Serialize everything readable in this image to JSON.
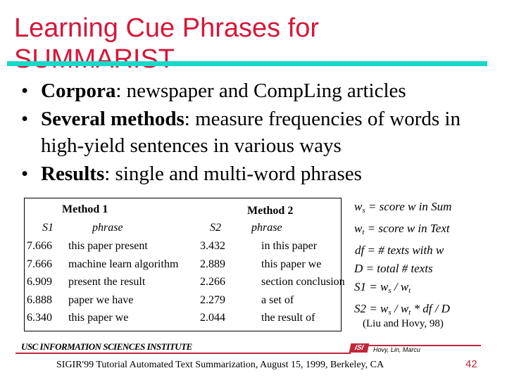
{
  "slide": {
    "title_line1": "Learning Cue Phrases for",
    "title_line2": "SUMMARIST",
    "accent_color": "#d5173a",
    "rule_color": "#19d8c8"
  },
  "bullets": [
    {
      "bold": "Corpora",
      "rest": ": newspaper and CompLing articles"
    },
    {
      "bold": "Several methods",
      "rest": ": measure frequencies of words in high-yield sentences in various ways"
    },
    {
      "bold": "Results",
      "rest": ": single and multi-word phrases"
    }
  ],
  "table": {
    "method1_header": "Method 1",
    "method2_header": "Method 2",
    "s1_header": "S1",
    "phrase1_header": "phrase",
    "s2_header": "S2",
    "phrase2_header": "phrase",
    "rows": [
      {
        "s1": "7.666",
        "p1": "this paper  present",
        "s2": "3.432",
        "p2": "in this paper"
      },
      {
        "s1": "7.666",
        "p1": "machine learn algorithm",
        "s2": "2.889",
        "p2": "this paper we"
      },
      {
        "s1": "6.909",
        "p1": "present the result",
        "s2": "2.266",
        "p2": "section conclusion"
      },
      {
        "s1": "6.888",
        "p1": "paper we have",
        "s2": "2.279",
        "p2": "a set of"
      },
      {
        "s1": "6.340",
        "p1": "this paper we",
        "s2": "2.044",
        "p2": "the result of"
      }
    ]
  },
  "definitions": {
    "ws": {
      "lhs": "w",
      "sub": "s",
      "rhs": " = score w in Sum"
    },
    "wt": {
      "lhs": "w",
      "sub": "t",
      "rhs": " = score w in Text"
    },
    "df": "df = # texts with w",
    "D": "D = total # texts",
    "s1": {
      "a": "S1 = w",
      "sub1": "s",
      "b": " / w",
      "sub2": "t",
      "c": ""
    },
    "s2": {
      "a": "S2 = w",
      "sub1": "s",
      "b": " / w",
      "sub2": "t",
      "c": " * df / D"
    },
    "citation": "(Liu and Hovy, 98)"
  },
  "footer": {
    "org": "USC INFORMATION SCIENCES INSTITUTE",
    "logo": "ISI",
    "authors": "Hovy, Lin, Marcu",
    "conference": "SIGIR'99 Tutorial Automated Text Summarization, August 15, 1999, Berkeley, CA",
    "page_number": "42"
  }
}
